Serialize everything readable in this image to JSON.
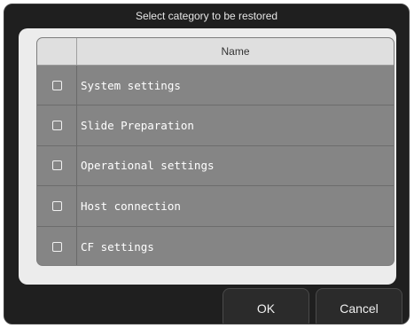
{
  "dialog": {
    "title": "Select category to be restored"
  },
  "table": {
    "header": {
      "name_label": "Name"
    },
    "rows": [
      {
        "label": "System settings",
        "checked": false
      },
      {
        "label": "Slide Preparation",
        "checked": false
      },
      {
        "label": "Operational settings",
        "checked": false
      },
      {
        "label": "Host connection",
        "checked": false
      },
      {
        "label": "CF settings",
        "checked": false
      }
    ]
  },
  "buttons": {
    "ok_label": "OK",
    "cancel_label": "Cancel"
  }
}
